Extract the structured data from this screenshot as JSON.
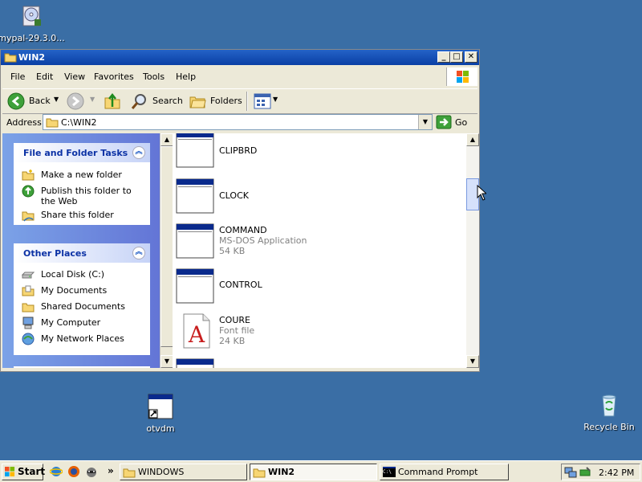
{
  "desktop": {
    "icons": [
      {
        "label": "mypal-29.3.0...",
        "icon": "installer-disc-icon"
      },
      {
        "label": "otvdm",
        "icon": "app-shortcut-icon"
      },
      {
        "label": "Recycle Bin",
        "icon": "recycle-bin-icon"
      }
    ]
  },
  "window": {
    "title": "WIN2",
    "controls": {
      "minimize": "_",
      "maximize": "□",
      "close": "✕"
    },
    "menu": [
      "File",
      "Edit",
      "View",
      "Favorites",
      "Tools",
      "Help"
    ],
    "toolbar": {
      "back": "Back",
      "search": "Search",
      "folders": "Folders"
    },
    "address": {
      "label": "Address",
      "value": "C:\\WIN2",
      "go": "Go"
    },
    "tasks": {
      "file_folder_tasks": {
        "title": "File and Folder Tasks",
        "items": [
          "Make a new folder",
          "Publish this folder to the Web",
          "Share this folder"
        ]
      },
      "other_places": {
        "title": "Other Places",
        "items": [
          "Local Disk (C:)",
          "My Documents",
          "Shared Documents",
          "My Computer",
          "My Network Places"
        ]
      }
    },
    "files": [
      {
        "name": "CLIPBRD",
        "type": "",
        "size": ""
      },
      {
        "name": "CLOCK",
        "type": "",
        "size": ""
      },
      {
        "name": "COMMAND",
        "type": "MS-DOS Application",
        "size": "54 KB"
      },
      {
        "name": "CONTROL",
        "type": "",
        "size": ""
      },
      {
        "name": "COURE",
        "type": "Font file",
        "size": "24 KB"
      }
    ],
    "font_icon_letter": "A"
  },
  "taskbar": {
    "start": "Start",
    "quick_launch_chevron": "»",
    "tasks": [
      "WINDOWS",
      "WIN2",
      "Command Prompt"
    ],
    "cmd_icon_text": "C:\\",
    "clock": "2:42 PM"
  },
  "colors": {
    "desktop": "#3a6ea5",
    "titlebar": "#0a3fa5",
    "taskpane": "#6375d6"
  }
}
